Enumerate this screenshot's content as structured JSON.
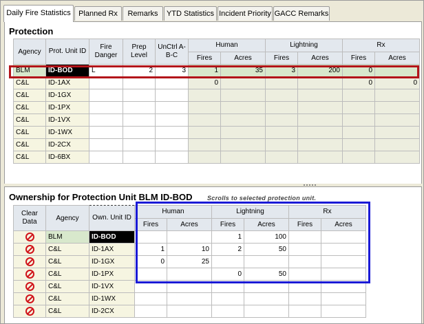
{
  "tabs": [
    {
      "label": "Daily Fire Statistics",
      "active": true
    },
    {
      "label": "Planned Rx",
      "active": false
    },
    {
      "label": "Remarks",
      "active": false
    },
    {
      "label": "YTD Statistics",
      "active": false
    },
    {
      "label": "Incident Priority",
      "active": false
    },
    {
      "label": "GACC Remarks",
      "active": false
    }
  ],
  "protection": {
    "title": "Protection",
    "headers": {
      "agency": "Agency",
      "prot_unit_id": "Prot. Unit ID",
      "fire_danger": "Fire Danger",
      "prep_level": "Prep Level",
      "unctrl": "UnCtrl A-B-C",
      "human": "Human",
      "lightning": "Lightning",
      "rx": "Rx",
      "fires": "Fires",
      "acres": "Acres"
    },
    "rows": [
      {
        "agency": "BLM",
        "unit": "ID-BOD",
        "fire_danger": "L",
        "prep_level": "2",
        "unctrl": "3",
        "human_fires": "1",
        "human_acres": "35",
        "lightning_fires": "3",
        "lightning_acres": "200",
        "rx_fires": "0",
        "rx_acres": "",
        "selected": true
      },
      {
        "agency": "C&L",
        "unit": "ID-1AX",
        "fire_danger": "",
        "prep_level": "",
        "unctrl": "",
        "human_fires": "0",
        "human_acres": "",
        "lightning_fires": "",
        "lightning_acres": "",
        "rx_fires": "0",
        "rx_acres": "0"
      },
      {
        "agency": "C&L",
        "unit": "ID-1GX",
        "fire_danger": "",
        "prep_level": "",
        "unctrl": "",
        "human_fires": "",
        "human_acres": "",
        "lightning_fires": "",
        "lightning_acres": "",
        "rx_fires": "",
        "rx_acres": ""
      },
      {
        "agency": "C&L",
        "unit": "ID-1PX",
        "fire_danger": "",
        "prep_level": "",
        "unctrl": "",
        "human_fires": "",
        "human_acres": "",
        "lightning_fires": "",
        "lightning_acres": "",
        "rx_fires": "",
        "rx_acres": ""
      },
      {
        "agency": "C&L",
        "unit": "ID-1VX",
        "fire_danger": "",
        "prep_level": "",
        "unctrl": "",
        "human_fires": "",
        "human_acres": "",
        "lightning_fires": "",
        "lightning_acres": "",
        "rx_fires": "",
        "rx_acres": ""
      },
      {
        "agency": "C&L",
        "unit": "ID-1WX",
        "fire_danger": "",
        "prep_level": "",
        "unctrl": "",
        "human_fires": "",
        "human_acres": "",
        "lightning_fires": "",
        "lightning_acres": "",
        "rx_fires": "",
        "rx_acres": ""
      },
      {
        "agency": "C&L",
        "unit": "ID-2CX",
        "fire_danger": "",
        "prep_level": "",
        "unctrl": "",
        "human_fires": "",
        "human_acres": "",
        "lightning_fires": "",
        "lightning_acres": "",
        "rx_fires": "",
        "rx_acres": ""
      },
      {
        "agency": "C&L",
        "unit": "ID-6BX",
        "fire_danger": "",
        "prep_level": "",
        "unctrl": "",
        "human_fires": "",
        "human_acres": "",
        "lightning_fires": "",
        "lightning_acres": "",
        "rx_fires": "",
        "rx_acres": ""
      }
    ]
  },
  "ownership": {
    "title": "Ownership for Protection Unit BLM ID-BOD",
    "hint": "Scrolls to selected protection unit.",
    "headers": {
      "clear_data": "Clear Data",
      "agency": "Agency",
      "own_unit_id": "Own. Unit ID",
      "human": "Human",
      "lightning": "Lightning",
      "rx": "Rx",
      "fires": "Fires",
      "acres": "Acres"
    },
    "rows": [
      {
        "agency": "BLM",
        "unit": "ID-BOD",
        "human_fires": "",
        "human_acres": "",
        "lightning_fires": "1",
        "lightning_acres": "100",
        "rx_fires": "",
        "rx_acres": "",
        "selected": true
      },
      {
        "agency": "C&L",
        "unit": "ID-1AX",
        "human_fires": "1",
        "human_acres": "10",
        "lightning_fires": "2",
        "lightning_acres": "50",
        "rx_fires": "",
        "rx_acres": ""
      },
      {
        "agency": "C&L",
        "unit": "ID-1GX",
        "human_fires": "0",
        "human_acres": "25",
        "lightning_fires": "",
        "lightning_acres": "",
        "rx_fires": "",
        "rx_acres": ""
      },
      {
        "agency": "C&L",
        "unit": "ID-1PX",
        "human_fires": "",
        "human_acres": "",
        "lightning_fires": "0",
        "lightning_acres": "50",
        "rx_fires": "",
        "rx_acres": ""
      },
      {
        "agency": "C&L",
        "unit": "ID-1VX",
        "human_fires": "",
        "human_acres": "",
        "lightning_fires": "",
        "lightning_acres": "",
        "rx_fires": "",
        "rx_acres": ""
      },
      {
        "agency": "C&L",
        "unit": "ID-1WX",
        "human_fires": "",
        "human_acres": "",
        "lightning_fires": "",
        "lightning_acres": "",
        "rx_fires": "",
        "rx_acres": ""
      },
      {
        "agency": "C&L",
        "unit": "ID-2CX",
        "human_fires": "",
        "human_acres": "",
        "lightning_fires": "",
        "lightning_acres": "",
        "rx_fires": "",
        "rx_acres": ""
      }
    ]
  },
  "icons": {
    "clear": "clear-data-icon"
  },
  "colors": {
    "selection_outline": "#b3141a",
    "ownership_outline": "#1a1ad6",
    "selected_unit_bg": "#000000"
  }
}
